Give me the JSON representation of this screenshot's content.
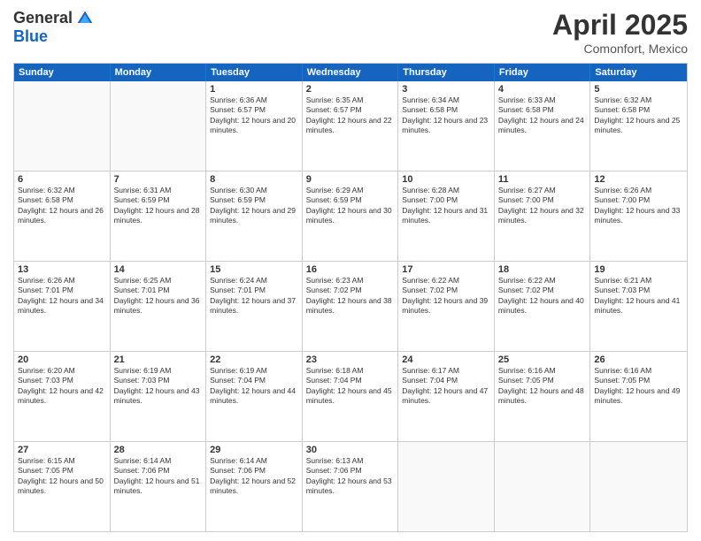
{
  "logo": {
    "general": "General",
    "blue": "Blue"
  },
  "title": "April 2025",
  "location": "Comonfort, Mexico",
  "days": [
    "Sunday",
    "Monday",
    "Tuesday",
    "Wednesday",
    "Thursday",
    "Friday",
    "Saturday"
  ],
  "weeks": [
    [
      {
        "day": "",
        "content": ""
      },
      {
        "day": "",
        "content": ""
      },
      {
        "day": "1",
        "content": "Sunrise: 6:36 AM\nSunset: 6:57 PM\nDaylight: 12 hours and 20 minutes."
      },
      {
        "day": "2",
        "content": "Sunrise: 6:35 AM\nSunset: 6:57 PM\nDaylight: 12 hours and 22 minutes."
      },
      {
        "day": "3",
        "content": "Sunrise: 6:34 AM\nSunset: 6:58 PM\nDaylight: 12 hours and 23 minutes."
      },
      {
        "day": "4",
        "content": "Sunrise: 6:33 AM\nSunset: 6:58 PM\nDaylight: 12 hours and 24 minutes."
      },
      {
        "day": "5",
        "content": "Sunrise: 6:32 AM\nSunset: 6:58 PM\nDaylight: 12 hours and 25 minutes."
      }
    ],
    [
      {
        "day": "6",
        "content": "Sunrise: 6:32 AM\nSunset: 6:58 PM\nDaylight: 12 hours and 26 minutes."
      },
      {
        "day": "7",
        "content": "Sunrise: 6:31 AM\nSunset: 6:59 PM\nDaylight: 12 hours and 28 minutes."
      },
      {
        "day": "8",
        "content": "Sunrise: 6:30 AM\nSunset: 6:59 PM\nDaylight: 12 hours and 29 minutes."
      },
      {
        "day": "9",
        "content": "Sunrise: 6:29 AM\nSunset: 6:59 PM\nDaylight: 12 hours and 30 minutes."
      },
      {
        "day": "10",
        "content": "Sunrise: 6:28 AM\nSunset: 7:00 PM\nDaylight: 12 hours and 31 minutes."
      },
      {
        "day": "11",
        "content": "Sunrise: 6:27 AM\nSunset: 7:00 PM\nDaylight: 12 hours and 32 minutes."
      },
      {
        "day": "12",
        "content": "Sunrise: 6:26 AM\nSunset: 7:00 PM\nDaylight: 12 hours and 33 minutes."
      }
    ],
    [
      {
        "day": "13",
        "content": "Sunrise: 6:26 AM\nSunset: 7:01 PM\nDaylight: 12 hours and 34 minutes."
      },
      {
        "day": "14",
        "content": "Sunrise: 6:25 AM\nSunset: 7:01 PM\nDaylight: 12 hours and 36 minutes."
      },
      {
        "day": "15",
        "content": "Sunrise: 6:24 AM\nSunset: 7:01 PM\nDaylight: 12 hours and 37 minutes."
      },
      {
        "day": "16",
        "content": "Sunrise: 6:23 AM\nSunset: 7:02 PM\nDaylight: 12 hours and 38 minutes."
      },
      {
        "day": "17",
        "content": "Sunrise: 6:22 AM\nSunset: 7:02 PM\nDaylight: 12 hours and 39 minutes."
      },
      {
        "day": "18",
        "content": "Sunrise: 6:22 AM\nSunset: 7:02 PM\nDaylight: 12 hours and 40 minutes."
      },
      {
        "day": "19",
        "content": "Sunrise: 6:21 AM\nSunset: 7:03 PM\nDaylight: 12 hours and 41 minutes."
      }
    ],
    [
      {
        "day": "20",
        "content": "Sunrise: 6:20 AM\nSunset: 7:03 PM\nDaylight: 12 hours and 42 minutes."
      },
      {
        "day": "21",
        "content": "Sunrise: 6:19 AM\nSunset: 7:03 PM\nDaylight: 12 hours and 43 minutes."
      },
      {
        "day": "22",
        "content": "Sunrise: 6:19 AM\nSunset: 7:04 PM\nDaylight: 12 hours and 44 minutes."
      },
      {
        "day": "23",
        "content": "Sunrise: 6:18 AM\nSunset: 7:04 PM\nDaylight: 12 hours and 45 minutes."
      },
      {
        "day": "24",
        "content": "Sunrise: 6:17 AM\nSunset: 7:04 PM\nDaylight: 12 hours and 47 minutes."
      },
      {
        "day": "25",
        "content": "Sunrise: 6:16 AM\nSunset: 7:05 PM\nDaylight: 12 hours and 48 minutes."
      },
      {
        "day": "26",
        "content": "Sunrise: 6:16 AM\nSunset: 7:05 PM\nDaylight: 12 hours and 49 minutes."
      }
    ],
    [
      {
        "day": "27",
        "content": "Sunrise: 6:15 AM\nSunset: 7:05 PM\nDaylight: 12 hours and 50 minutes."
      },
      {
        "day": "28",
        "content": "Sunrise: 6:14 AM\nSunset: 7:06 PM\nDaylight: 12 hours and 51 minutes."
      },
      {
        "day": "29",
        "content": "Sunrise: 6:14 AM\nSunset: 7:06 PM\nDaylight: 12 hours and 52 minutes."
      },
      {
        "day": "30",
        "content": "Sunrise: 6:13 AM\nSunset: 7:06 PM\nDaylight: 12 hours and 53 minutes."
      },
      {
        "day": "",
        "content": ""
      },
      {
        "day": "",
        "content": ""
      },
      {
        "day": "",
        "content": ""
      }
    ]
  ]
}
